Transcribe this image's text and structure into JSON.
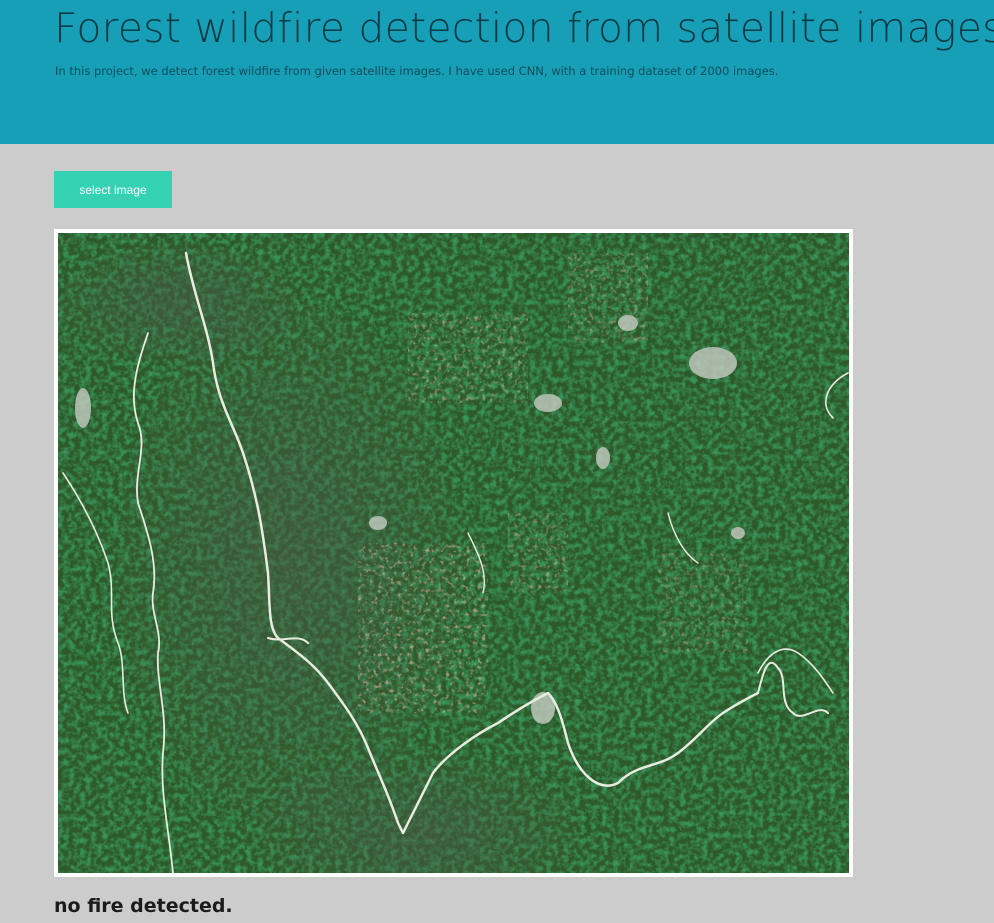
{
  "header": {
    "title": "Forest wildfire detection from satellite images",
    "description": "In this project, we detect forest wildfire from given satellite images. I have used CNN, with a training dataset of 2000 images."
  },
  "controls": {
    "select_image_label": "select image"
  },
  "result": {
    "text": "no fire detected."
  },
  "colors": {
    "header_bg": "#169fb6",
    "page_bg": "#cccccc",
    "button_bg": "#34d1b3",
    "button_text": "#ffffff",
    "title_text": "#0c3a44"
  }
}
